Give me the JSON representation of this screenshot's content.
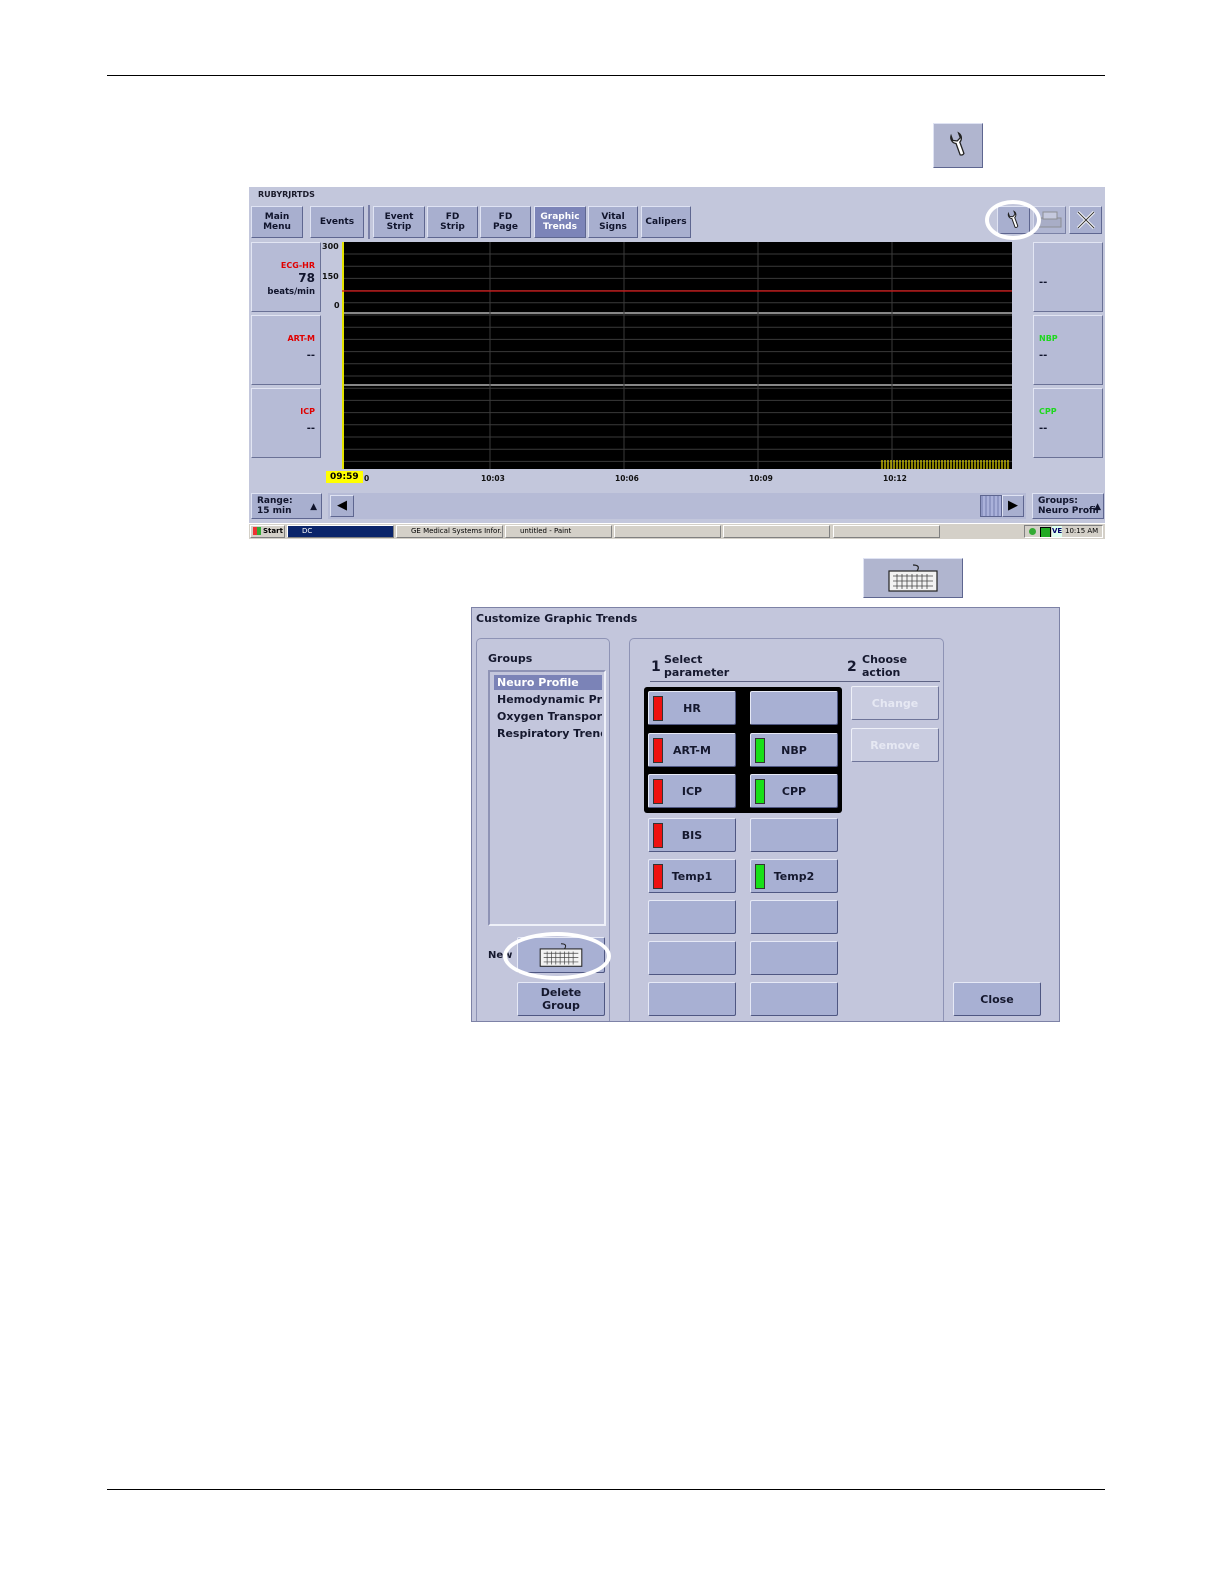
{
  "toolbar_icons": {
    "wrench_icon": "wrench-icon",
    "keyboard_icon": "keyboard-icon"
  },
  "monitor": {
    "title": "RUBYRJRTDS",
    "nav_buttons": [
      {
        "label": "Main\nMenu"
      },
      {
        "label": "Events"
      },
      {
        "label": "Event\nStrip"
      },
      {
        "label": "FD\nStrip"
      },
      {
        "label": "FD\nPage"
      },
      {
        "label": "Graphic\nTrends",
        "active": true
      },
      {
        "label": "Vital\nSigns"
      },
      {
        "label": "Calipers"
      }
    ],
    "left_params": [
      {
        "label": "ECG-HR",
        "value": "78",
        "unit": "beats/min",
        "color": "#e00000"
      },
      {
        "label": "ART-M",
        "value": "--",
        "color": "#e00000"
      },
      {
        "label": "ICP",
        "value": "--",
        "color": "#e00000"
      }
    ],
    "right_params": [
      {
        "label": "",
        "value": "--",
        "color": "#1a1a2a"
      },
      {
        "label": "NBP",
        "value": "--",
        "color": "#1ed81e"
      },
      {
        "label": "CPP",
        "value": "--",
        "color": "#1ed81e"
      }
    ],
    "y_ticks": [
      "300",
      "150",
      "0"
    ],
    "start_time": "09:59",
    "x_ticks": [
      "0",
      "10:03",
      "10:06",
      "10:09",
      "10:12"
    ],
    "trend_line_color": "#d81818",
    "range_label": "Range:\n15 min",
    "groups_label": "Groups:\nNeuro Profil",
    "taskbar": {
      "start": "Start",
      "items": [
        "DC",
        "GE Medical Systems Infor...",
        "untitled - Paint",
        "",
        "",
        ""
      ],
      "clock": "10:15 AM",
      "tray_text": "VE"
    }
  },
  "dialog": {
    "title": "Customize Graphic Trends",
    "groups_heading": "Groups",
    "groups": [
      "Neuro Profile",
      "Hemodynamic Prof",
      "Oxygen Transport",
      "Respiratory Trends"
    ],
    "selected_group": 0,
    "new_label": "New",
    "delete_group_label": "Delete\nGroup",
    "step1_num": "1",
    "step1_text": "Select\nparameter",
    "step2_num": "2",
    "step2_text": "Choose\naction",
    "change_label": "Change",
    "remove_label": "Remove",
    "close_label": "Close",
    "param_grid": [
      [
        {
          "label": "HR",
          "ind": "red"
        },
        {
          "label": "",
          "ind": ""
        }
      ],
      [
        {
          "label": "ART-M",
          "ind": "red"
        },
        {
          "label": "NBP",
          "ind": "green"
        }
      ],
      [
        {
          "label": "ICP",
          "ind": "red"
        },
        {
          "label": "CPP",
          "ind": "green"
        }
      ],
      [
        {
          "label": "BIS",
          "ind": "red"
        },
        {
          "label": "",
          "ind": ""
        }
      ],
      [
        {
          "label": "Temp1",
          "ind": "red"
        },
        {
          "label": "Temp2",
          "ind": "green"
        }
      ],
      [
        {
          "label": "",
          "ind": ""
        },
        {
          "label": "",
          "ind": ""
        }
      ],
      [
        {
          "label": "",
          "ind": ""
        },
        {
          "label": "",
          "ind": ""
        }
      ],
      [
        {
          "label": "",
          "ind": ""
        },
        {
          "label": "",
          "ind": ""
        }
      ]
    ]
  }
}
